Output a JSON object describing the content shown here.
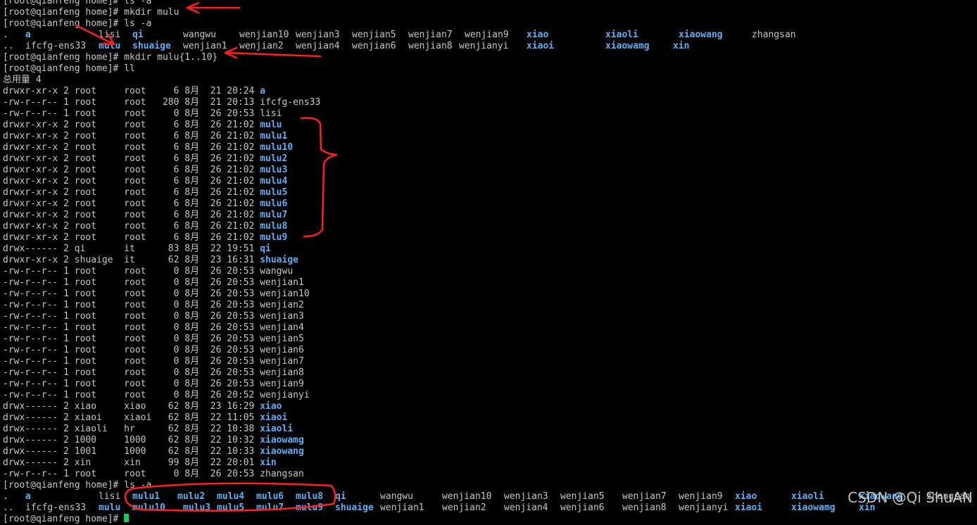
{
  "terminal": {
    "colors": {
      "background": "#000000",
      "text": "#c7c7c7",
      "directory": "#5cb0f4",
      "cursor": "#22c55e",
      "annotation": "#ff2020"
    },
    "lines": [
      {
        "type": "prompt",
        "text": "[root@qianfeng home]# ls -a"
      },
      {
        "type": "prompt",
        "text": "[root@qianfeng home]# mkdir mulu"
      },
      {
        "type": "prompt",
        "text": "[root@qianfeng home]# ls -a"
      },
      {
        "type": "grid",
        "cells": [
          [
            ".",
            ""
          ],
          [
            "a",
            "d"
          ],
          [
            "lisi",
            ""
          ],
          [
            "qi",
            "d"
          ],
          [
            "wangwu",
            ""
          ],
          [
            "wenjian10",
            ""
          ],
          [
            "wenjian3",
            ""
          ],
          [
            "wenjian5",
            ""
          ],
          [
            "wenjian7",
            ""
          ],
          [
            "wenjian9",
            ""
          ],
          [
            "xiao",
            "d"
          ],
          [
            "xiaoli",
            "d"
          ],
          [
            "xiaowang",
            "d"
          ],
          [
            "zhangsan",
            ""
          ]
        ]
      },
      {
        "type": "grid",
        "cells": [
          [
            "..",
            ""
          ],
          [
            "ifcfg-ens33",
            ""
          ],
          [
            "mulu",
            "d"
          ],
          [
            "shuaige",
            "d"
          ],
          [
            "wenjian1",
            ""
          ],
          [
            "wenjian2",
            ""
          ],
          [
            "wenjian4",
            ""
          ],
          [
            "wenjian6",
            ""
          ],
          [
            "wenjian8",
            ""
          ],
          [
            "wenjianyi",
            ""
          ],
          [
            "xiaoi",
            "d"
          ],
          [
            "xiaowamg",
            "d"
          ],
          [
            "xin",
            "d"
          ]
        ]
      },
      {
        "type": "prompt",
        "text": "[root@qianfeng home]# mkdir mulu{1..10}"
      },
      {
        "type": "prompt",
        "text": "[root@qianfeng home]# ll"
      },
      {
        "type": "text",
        "text": "总用量 4"
      },
      {
        "type": "ll",
        "perm": "drwxr-xr-x",
        "links": "2",
        "user": "root",
        "group": "root",
        "size": "6",
        "month": "8月",
        "day": "21",
        "time": "20:24",
        "name": "a",
        "dir": true
      },
      {
        "type": "ll",
        "perm": "-rw-r--r--",
        "links": "1",
        "user": "root",
        "group": "root",
        "size": "280",
        "month": "8月",
        "day": "21",
        "time": "20:13",
        "name": "ifcfg-ens33",
        "dir": false
      },
      {
        "type": "ll",
        "perm": "-rw-r--r--",
        "links": "1",
        "user": "root",
        "group": "root",
        "size": "0",
        "month": "8月",
        "day": "26",
        "time": "20:53",
        "name": "lisi",
        "dir": false
      },
      {
        "type": "ll",
        "perm": "drwxr-xr-x",
        "links": "2",
        "user": "root",
        "group": "root",
        "size": "6",
        "month": "8月",
        "day": "26",
        "time": "21:02",
        "name": "mulu",
        "dir": true
      },
      {
        "type": "ll",
        "perm": "drwxr-xr-x",
        "links": "2",
        "user": "root",
        "group": "root",
        "size": "6",
        "month": "8月",
        "day": "26",
        "time": "21:02",
        "name": "mulu1",
        "dir": true
      },
      {
        "type": "ll",
        "perm": "drwxr-xr-x",
        "links": "2",
        "user": "root",
        "group": "root",
        "size": "6",
        "month": "8月",
        "day": "26",
        "time": "21:02",
        "name": "mulu10",
        "dir": true
      },
      {
        "type": "ll",
        "perm": "drwxr-xr-x",
        "links": "2",
        "user": "root",
        "group": "root",
        "size": "6",
        "month": "8月",
        "day": "26",
        "time": "21:02",
        "name": "mulu2",
        "dir": true
      },
      {
        "type": "ll",
        "perm": "drwxr-xr-x",
        "links": "2",
        "user": "root",
        "group": "root",
        "size": "6",
        "month": "8月",
        "day": "26",
        "time": "21:02",
        "name": "mulu3",
        "dir": true
      },
      {
        "type": "ll",
        "perm": "drwxr-xr-x",
        "links": "2",
        "user": "root",
        "group": "root",
        "size": "6",
        "month": "8月",
        "day": "26",
        "time": "21:02",
        "name": "mulu4",
        "dir": true
      },
      {
        "type": "ll",
        "perm": "drwxr-xr-x",
        "links": "2",
        "user": "root",
        "group": "root",
        "size": "6",
        "month": "8月",
        "day": "26",
        "time": "21:02",
        "name": "mulu5",
        "dir": true
      },
      {
        "type": "ll",
        "perm": "drwxr-xr-x",
        "links": "2",
        "user": "root",
        "group": "root",
        "size": "6",
        "month": "8月",
        "day": "26",
        "time": "21:02",
        "name": "mulu6",
        "dir": true
      },
      {
        "type": "ll",
        "perm": "drwxr-xr-x",
        "links": "2",
        "user": "root",
        "group": "root",
        "size": "6",
        "month": "8月",
        "day": "26",
        "time": "21:02",
        "name": "mulu7",
        "dir": true
      },
      {
        "type": "ll",
        "perm": "drwxr-xr-x",
        "links": "2",
        "user": "root",
        "group": "root",
        "size": "6",
        "month": "8月",
        "day": "26",
        "time": "21:02",
        "name": "mulu8",
        "dir": true
      },
      {
        "type": "ll",
        "perm": "drwxr-xr-x",
        "links": "2",
        "user": "root",
        "group": "root",
        "size": "6",
        "month": "8月",
        "day": "26",
        "time": "21:02",
        "name": "mulu9",
        "dir": true
      },
      {
        "type": "ll",
        "perm": "drwx------",
        "links": "2",
        "user": "qi",
        "group": "it",
        "size": "83",
        "month": "8月",
        "day": "22",
        "time": "19:51",
        "name": "qi",
        "dir": true
      },
      {
        "type": "ll",
        "perm": "drwxr-xr-x",
        "links": "2",
        "user": "shuaige",
        "group": "it",
        "size": "62",
        "month": "8月",
        "day": "23",
        "time": "16:31",
        "name": "shuaige",
        "dir": true
      },
      {
        "type": "ll",
        "perm": "-rw-r--r--",
        "links": "1",
        "user": "root",
        "group": "root",
        "size": "0",
        "month": "8月",
        "day": "26",
        "time": "20:53",
        "name": "wangwu",
        "dir": false
      },
      {
        "type": "ll",
        "perm": "-rw-r--r--",
        "links": "1",
        "user": "root",
        "group": "root",
        "size": "0",
        "month": "8月",
        "day": "26",
        "time": "20:53",
        "name": "wenjian1",
        "dir": false
      },
      {
        "type": "ll",
        "perm": "-rw-r--r--",
        "links": "1",
        "user": "root",
        "group": "root",
        "size": "0",
        "month": "8月",
        "day": "26",
        "time": "20:53",
        "name": "wenjian10",
        "dir": false
      },
      {
        "type": "ll",
        "perm": "-rw-r--r--",
        "links": "1",
        "user": "root",
        "group": "root",
        "size": "0",
        "month": "8月",
        "day": "26",
        "time": "20:53",
        "name": "wenjian2",
        "dir": false
      },
      {
        "type": "ll",
        "perm": "-rw-r--r--",
        "links": "1",
        "user": "root",
        "group": "root",
        "size": "0",
        "month": "8月",
        "day": "26",
        "time": "20:53",
        "name": "wenjian3",
        "dir": false
      },
      {
        "type": "ll",
        "perm": "-rw-r--r--",
        "links": "1",
        "user": "root",
        "group": "root",
        "size": "0",
        "month": "8月",
        "day": "26",
        "time": "20:53",
        "name": "wenjian4",
        "dir": false
      },
      {
        "type": "ll",
        "perm": "-rw-r--r--",
        "links": "1",
        "user": "root",
        "group": "root",
        "size": "0",
        "month": "8月",
        "day": "26",
        "time": "20:53",
        "name": "wenjian5",
        "dir": false
      },
      {
        "type": "ll",
        "perm": "-rw-r--r--",
        "links": "1",
        "user": "root",
        "group": "root",
        "size": "0",
        "month": "8月",
        "day": "26",
        "time": "20:53",
        "name": "wenjian6",
        "dir": false
      },
      {
        "type": "ll",
        "perm": "-rw-r--r--",
        "links": "1",
        "user": "root",
        "group": "root",
        "size": "0",
        "month": "8月",
        "day": "26",
        "time": "20:53",
        "name": "wenjian7",
        "dir": false
      },
      {
        "type": "ll",
        "perm": "-rw-r--r--",
        "links": "1",
        "user": "root",
        "group": "root",
        "size": "0",
        "month": "8月",
        "day": "26",
        "time": "20:53",
        "name": "wenjian8",
        "dir": false
      },
      {
        "type": "ll",
        "perm": "-rw-r--r--",
        "links": "1",
        "user": "root",
        "group": "root",
        "size": "0",
        "month": "8月",
        "day": "26",
        "time": "20:53",
        "name": "wenjian9",
        "dir": false
      },
      {
        "type": "ll",
        "perm": "-rw-r--r--",
        "links": "1",
        "user": "root",
        "group": "root",
        "size": "0",
        "month": "8月",
        "day": "26",
        "time": "20:52",
        "name": "wenjianyi",
        "dir": false
      },
      {
        "type": "ll",
        "perm": "drwx------",
        "links": "2",
        "user": "xiao",
        "group": "xiao",
        "size": "62",
        "month": "8月",
        "day": "23",
        "time": "16:29",
        "name": "xiao",
        "dir": true
      },
      {
        "type": "ll",
        "perm": "drwx------",
        "links": "2",
        "user": "xiaoi",
        "group": "xiaoi",
        "size": "62",
        "month": "8月",
        "day": "22",
        "time": "11:05",
        "name": "xiaoi",
        "dir": true
      },
      {
        "type": "ll",
        "perm": "drwx------",
        "links": "2",
        "user": "xiaoli",
        "group": "hr",
        "size": "62",
        "month": "8月",
        "day": "22",
        "time": "10:38",
        "name": "xiaoli",
        "dir": true
      },
      {
        "type": "ll",
        "perm": "drwx------",
        "links": "2",
        "user": "1000",
        "group": "1000",
        "size": "62",
        "month": "8月",
        "day": "22",
        "time": "10:32",
        "name": "xiaowamg",
        "dir": true
      },
      {
        "type": "ll",
        "perm": "drwx------",
        "links": "2",
        "user": "1001",
        "group": "1000",
        "size": "62",
        "month": "8月",
        "day": "22",
        "time": "10:33",
        "name": "xiaowang",
        "dir": true
      },
      {
        "type": "ll",
        "perm": "drwx------",
        "links": "2",
        "user": "xin",
        "group": "xin",
        "size": "99",
        "month": "8月",
        "day": "22",
        "time": "20:01",
        "name": "xin",
        "dir": true
      },
      {
        "type": "ll",
        "perm": "-rw-r--r--",
        "links": "1",
        "user": "root",
        "group": "root",
        "size": "0",
        "month": "8月",
        "day": "26",
        "time": "20:53",
        "name": "zhangsan",
        "dir": false
      },
      {
        "type": "prompt",
        "text": "[root@qianfeng home]# ls -a"
      },
      {
        "type": "grid",
        "cells": [
          [
            ".",
            ""
          ],
          [
            "a",
            "d"
          ],
          [
            "lisi",
            ""
          ],
          [
            "mulu1",
            "d"
          ],
          [
            "mulu2",
            "d"
          ],
          [
            "mulu4",
            "d"
          ],
          [
            "mulu6",
            "d"
          ],
          [
            "mulu8",
            "d"
          ],
          [
            "qi",
            "d"
          ],
          [
            "wangwu",
            ""
          ],
          [
            "wenjian10",
            ""
          ],
          [
            "wenjian3",
            ""
          ],
          [
            "wenjian5",
            ""
          ],
          [
            "wenjian7",
            ""
          ],
          [
            "wenjian9",
            ""
          ],
          [
            "xiao",
            "d"
          ],
          [
            "xiaoli",
            "d"
          ],
          [
            "xiaowang",
            "d"
          ],
          [
            "zhangsan",
            ""
          ]
        ]
      },
      {
        "type": "grid",
        "cells": [
          [
            "..",
            ""
          ],
          [
            "ifcfg-ens33",
            ""
          ],
          [
            "mulu",
            "d"
          ],
          [
            "mulu10",
            "d"
          ],
          [
            "mulu3",
            "d"
          ],
          [
            "mulu5",
            "d"
          ],
          [
            "mulu7",
            "d"
          ],
          [
            "mulu9",
            "d"
          ],
          [
            "shuaige",
            "d"
          ],
          [
            "wenjian1",
            ""
          ],
          [
            "wenjian2",
            ""
          ],
          [
            "wenjian4",
            ""
          ],
          [
            "wenjian6",
            ""
          ],
          [
            "wenjian8",
            ""
          ],
          [
            "wenjianyi",
            ""
          ],
          [
            "xiaoi",
            "d"
          ],
          [
            "xiaowamg",
            "d"
          ],
          [
            "xin",
            "d"
          ]
        ]
      },
      {
        "type": "prompt_cursor",
        "text": "[root@qianfeng home]# "
      }
    ]
  },
  "watermark": {
    "text": "CSDN @Qi ShuAN"
  }
}
